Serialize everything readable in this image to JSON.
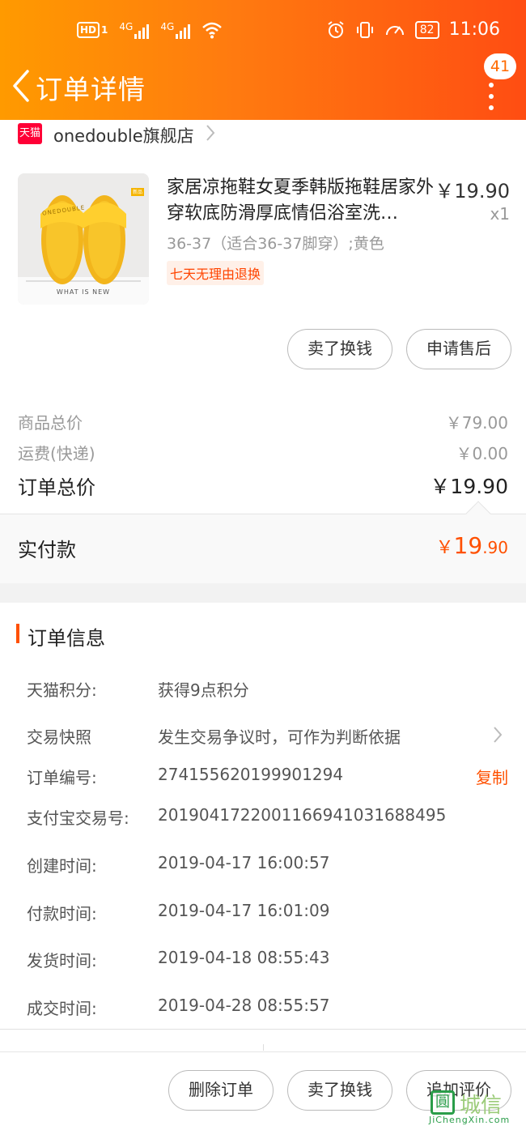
{
  "status_bar": {
    "hd": "HD",
    "sim_mark": "1",
    "net1": "4G",
    "net2": "4G",
    "battery": "82",
    "time": "11:06"
  },
  "nav": {
    "title": "订单详情",
    "badge_count": "41"
  },
  "store": {
    "badge": "天猫",
    "name": "onedouble旗舰店"
  },
  "product": {
    "name": "家居凉拖鞋女夏季韩版拖鞋居家外穿软底防滑厚底情侣浴室洗…",
    "price": "￥19.90",
    "qty": "x1",
    "sku": "36-37（适合36-37脚穿）;黄色",
    "tag": "七天无理由退换",
    "image_caption": "WHAT IS NEW",
    "image_brand": "ONEDOUBLE",
    "image_corner": "新品",
    "sell_label": "卖了换钱",
    "aftersale_label": "申请售后"
  },
  "prices": {
    "goods_label": "商品总价",
    "goods_value": "￥79.00",
    "shipping_label": "运费(快递)",
    "shipping_value": "￥0.00",
    "total_label": "订单总价",
    "total_value": "￥19.90",
    "paid_label": "实付款",
    "paid_currency": "￥",
    "paid_int": "19",
    "paid_dec": ".90"
  },
  "order_info": {
    "title": "订单信息",
    "points_label": "天猫积分:",
    "points_value": "获得9点积分",
    "snapshot_label": "交易快照",
    "snapshot_value": "发生交易争议时，可作为判断依据",
    "order_no_label": "订单编号:",
    "order_no_value": "274155620199901294",
    "copy_label": "复制",
    "alipay_label": "支付宝交易号:",
    "alipay_value": "2019041722001166941031688495",
    "created_label": "创建时间:",
    "created_value": "2019-04-17 16:00:57",
    "paid_time_label": "付款时间:",
    "paid_time_value": "2019-04-17 16:01:09",
    "shipped_label": "发货时间:",
    "shipped_value": "2019-04-18 08:55:43",
    "done_label": "成交时间:",
    "done_value": "2019-04-28 08:55:57"
  },
  "bottom_bar": {
    "delete_label": "删除订单",
    "sell_label": "卖了换钱",
    "review_label": "追加评价"
  },
  "watermark": {
    "box": "圓",
    "text": "城信",
    "sub": "JiChengXin.com"
  },
  "colors": {
    "accent": "#ff5000",
    "header_start": "#ff9a00",
    "header_end": "#ff4d12"
  }
}
